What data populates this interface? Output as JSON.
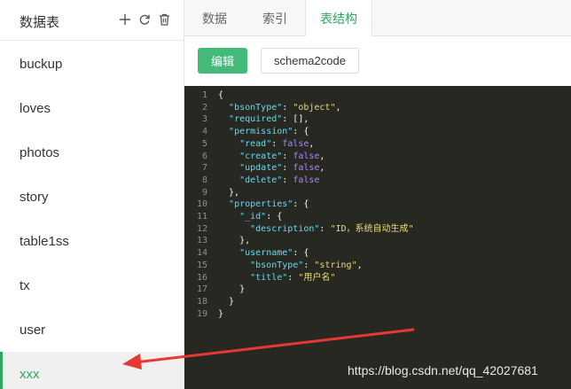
{
  "sidebar": {
    "title": "数据表",
    "icons": [
      "plus-icon",
      "refresh-icon",
      "trash-icon"
    ],
    "items": [
      {
        "label": "buckup",
        "active": false
      },
      {
        "label": "loves",
        "active": false
      },
      {
        "label": "photos",
        "active": false
      },
      {
        "label": "story",
        "active": false
      },
      {
        "label": "table1ss",
        "active": false
      },
      {
        "label": "tx",
        "active": false
      },
      {
        "label": "user",
        "active": false
      },
      {
        "label": "xxx",
        "active": true
      }
    ]
  },
  "tabs": [
    {
      "label": "数据",
      "active": false
    },
    {
      "label": "索引",
      "active": false
    },
    {
      "label": "表结构",
      "active": true
    }
  ],
  "toolbar": {
    "edit_label": "编辑",
    "schema2code_label": "schema2code"
  },
  "editor": {
    "lines": [
      {
        "n": "1",
        "tokens": [
          [
            "p",
            "{"
          ]
        ]
      },
      {
        "n": "2",
        "tokens": [
          [
            "p",
            "  "
          ],
          [
            "k",
            "\"bsonType\""
          ],
          [
            "p",
            ": "
          ],
          [
            "s",
            "\"object\""
          ],
          [
            "p",
            ","
          ]
        ]
      },
      {
        "n": "3",
        "tokens": [
          [
            "p",
            "  "
          ],
          [
            "k",
            "\"required\""
          ],
          [
            "p",
            ": [],"
          ]
        ]
      },
      {
        "n": "4",
        "tokens": [
          [
            "p",
            "  "
          ],
          [
            "k",
            "\"permission\""
          ],
          [
            "p",
            ": {"
          ]
        ]
      },
      {
        "n": "5",
        "tokens": [
          [
            "p",
            "    "
          ],
          [
            "k",
            "\"read\""
          ],
          [
            "p",
            ": "
          ],
          [
            "b",
            "false"
          ],
          [
            "p",
            ","
          ]
        ]
      },
      {
        "n": "6",
        "tokens": [
          [
            "p",
            "    "
          ],
          [
            "k",
            "\"create\""
          ],
          [
            "p",
            ": "
          ],
          [
            "b",
            "false"
          ],
          [
            "p",
            ","
          ]
        ]
      },
      {
        "n": "7",
        "tokens": [
          [
            "p",
            "    "
          ],
          [
            "k",
            "\"update\""
          ],
          [
            "p",
            ": "
          ],
          [
            "b",
            "false"
          ],
          [
            "p",
            ","
          ]
        ]
      },
      {
        "n": "8",
        "tokens": [
          [
            "p",
            "    "
          ],
          [
            "k",
            "\"delete\""
          ],
          [
            "p",
            ": "
          ],
          [
            "b",
            "false"
          ]
        ]
      },
      {
        "n": "9",
        "tokens": [
          [
            "p",
            "  },"
          ]
        ]
      },
      {
        "n": "10",
        "tokens": [
          [
            "p",
            "  "
          ],
          [
            "k",
            "\"properties\""
          ],
          [
            "p",
            ": {"
          ]
        ]
      },
      {
        "n": "11",
        "tokens": [
          [
            "p",
            "    "
          ],
          [
            "k",
            "\"_id\""
          ],
          [
            "p",
            ": {"
          ]
        ]
      },
      {
        "n": "12",
        "tokens": [
          [
            "p",
            "      "
          ],
          [
            "k",
            "\"description\""
          ],
          [
            "p",
            ": "
          ],
          [
            "s",
            "\"ID，系统自动生成\""
          ]
        ]
      },
      {
        "n": "13",
        "tokens": [
          [
            "p",
            "    },"
          ]
        ]
      },
      {
        "n": "14",
        "tokens": [
          [
            "p",
            "    "
          ],
          [
            "k",
            "\"username\""
          ],
          [
            "p",
            ": {"
          ]
        ]
      },
      {
        "n": "15",
        "tokens": [
          [
            "p",
            "      "
          ],
          [
            "k",
            "\"bsonType\""
          ],
          [
            "p",
            ": "
          ],
          [
            "s",
            "\"string\""
          ],
          [
            "p",
            ","
          ]
        ]
      },
      {
        "n": "16",
        "tokens": [
          [
            "p",
            "      "
          ],
          [
            "k",
            "\"title\""
          ],
          [
            "p",
            ": "
          ],
          [
            "s",
            "\"用户名\""
          ]
        ]
      },
      {
        "n": "17",
        "tokens": [
          [
            "p",
            "    }"
          ]
        ]
      },
      {
        "n": "18",
        "tokens": [
          [
            "p",
            "  }"
          ]
        ]
      },
      {
        "n": "19",
        "tokens": [
          [
            "p",
            "}"
          ]
        ]
      }
    ]
  },
  "watermark": "https://blog.csdn.net/qq_42027681",
  "colors": {
    "accent": "#2fa660",
    "button": "#43b97a",
    "editor_bg": "#272822",
    "annotation_arrow": "#e53935"
  }
}
